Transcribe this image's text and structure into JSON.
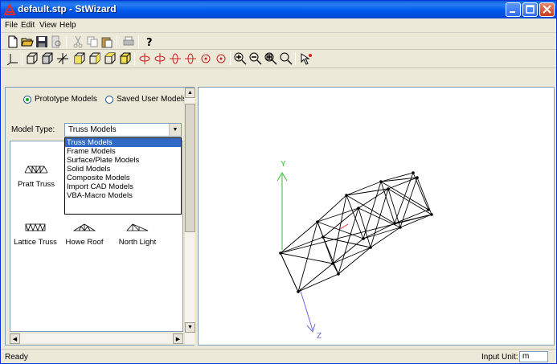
{
  "window": {
    "title": "default.stp - StWizard"
  },
  "menu": {
    "items": [
      "File",
      "Edit",
      "View",
      "Help"
    ]
  },
  "toolbar1": {
    "icons": [
      "new-file-icon",
      "open-folder-icon",
      "save-icon",
      "print-preview-icon",
      "cut-icon",
      "copy-icon",
      "paste-icon",
      "print-icon",
      "help-icon"
    ]
  },
  "toolbar2": {
    "icons": [
      "axes-icon",
      "view-box-1-icon",
      "view-box-2-icon",
      "perspective-icon",
      "view-front-icon",
      "view-side-icon",
      "view-top-icon",
      "view-iso-icon",
      "rotate-x-pos-icon",
      "rotate-x-neg-icon",
      "rotate-y-pos-icon",
      "rotate-y-neg-icon",
      "rotate-z-pos-icon",
      "rotate-z-neg-icon",
      "zoom-in-icon",
      "zoom-out-icon",
      "zoom-extents-icon",
      "zoom-window-icon",
      "select-pointer-icon"
    ]
  },
  "left_pane": {
    "radio_prototype": "Prototype Models",
    "radio_saved": "Saved User Models",
    "model_type_label": "Model Type:",
    "model_type_value": "Truss Models",
    "dropdown_options": [
      "Truss Models",
      "Frame Models",
      "Surface/Plate Models",
      "Solid Models",
      "Composite Models",
      "Import CAD Models",
      "VBA-Macro Models"
    ],
    "models": [
      {
        "label": "Pratt Truss",
        "icon": "pratt-truss-icon"
      },
      {
        "label": "Lattice Truss",
        "icon": "lattice-truss-icon"
      },
      {
        "label": "Howe Roof",
        "icon": "howe-roof-icon"
      },
      {
        "label": "North Light",
        "icon": "north-light-icon"
      }
    ]
  },
  "viewport": {
    "axis_y": "Y",
    "axis_z": "Z",
    "axis_y_color": "#2fc02f",
    "axis_z_color": "#6a6ae0",
    "axis_x_color": "#e03030"
  },
  "status": {
    "text": "Ready",
    "input_unit_label": "Input Unit:",
    "input_unit_value": "m"
  }
}
